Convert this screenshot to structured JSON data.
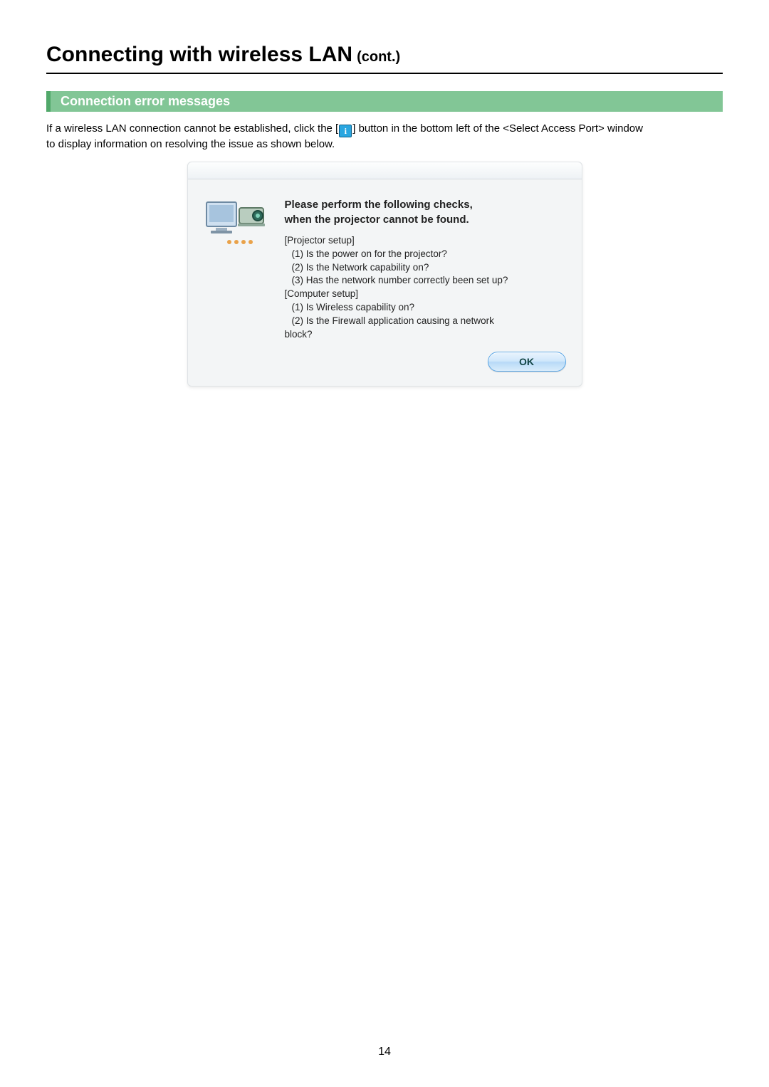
{
  "page": {
    "title": "Connecting with wireless LAN",
    "title_suffix": "(cont.)",
    "number": "14"
  },
  "section": {
    "heading": "Connection error messages",
    "intro_before": "If a wireless LAN connection cannot be established, click the [",
    "intro_icon_label": "i",
    "intro_after": "] button in the bottom left of the <Select Access Port> window",
    "intro_line2": "to display information on resolving the issue as shown below."
  },
  "dialog": {
    "heading_line1": "Please perform the following checks,",
    "heading_line2": "when the projector cannot  be found.",
    "group1_label": "[Projector setup]",
    "group1_items": [
      "(1) Is the power on for the projector?",
      "(2) Is the Network capability on?",
      "(3) Has the network number correctly been set up?"
    ],
    "group2_label": "[Computer setup]",
    "group2_items": [
      "(1) Is Wireless capability on?",
      "(2) Is the Firewall application causing a network"
    ],
    "group2_trail": "block?",
    "ok_label": "OK"
  }
}
